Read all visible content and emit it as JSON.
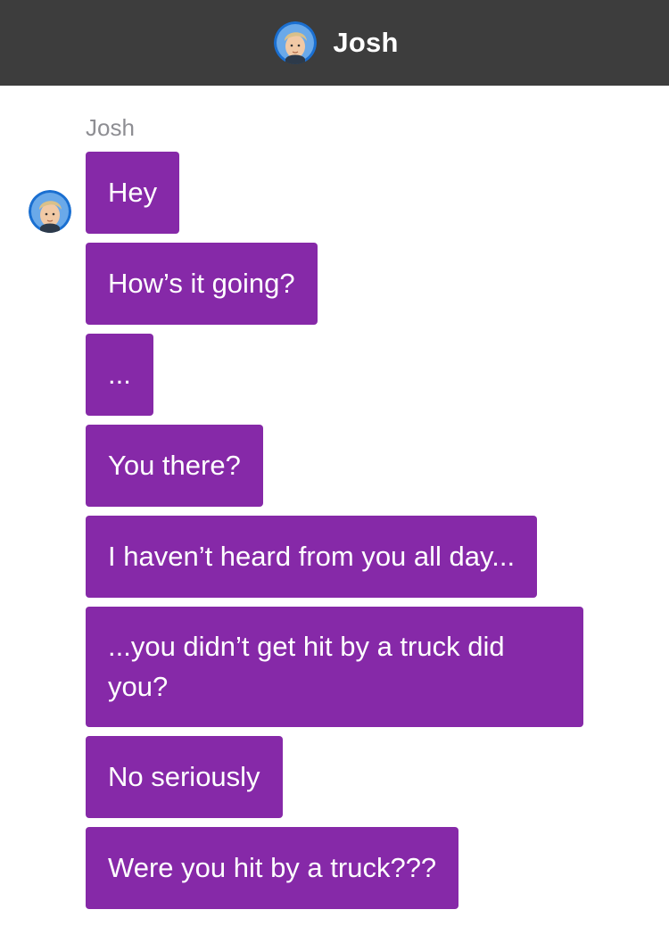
{
  "header": {
    "title": "Josh",
    "avatar_icon": "user-avatar-icon"
  },
  "conversation": {
    "sender_name": "Josh",
    "avatar_icon": "user-avatar-icon",
    "bubble_color": "#8629a8",
    "messages": [
      "Hey",
      "How’s it going?",
      "...",
      "You there?",
      "I haven’t heard from you all day...",
      "...you didn’t get hit by a truck did you?",
      "No seriously",
      "Were you hit by a truck???"
    ]
  },
  "colors": {
    "header_bg": "#3d3d3d",
    "page_bg": "#ffffff",
    "sender_name": "#8e8e93"
  }
}
